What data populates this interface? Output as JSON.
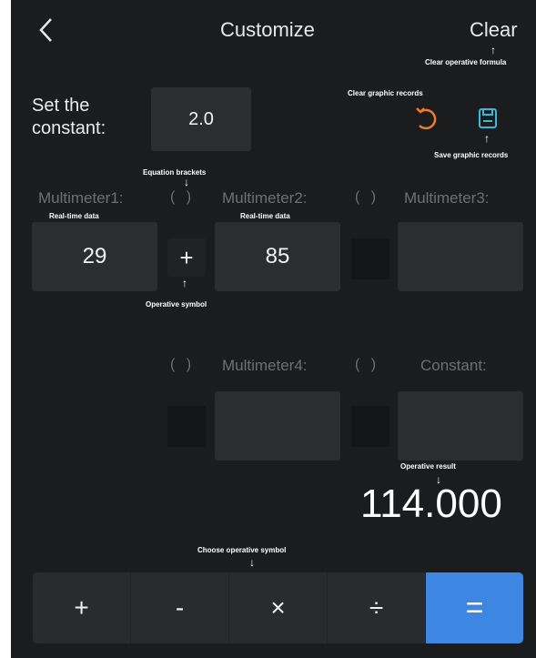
{
  "header": {
    "back_icon": "chevron-left-icon",
    "title": "Customize",
    "clear_label": "Clear"
  },
  "constant": {
    "label_line1": "Set the",
    "label_line2": "constant:",
    "value": "2.0"
  },
  "actions": {
    "clear_records_icon": "undo-icon",
    "save_records_icon": "save-icon",
    "accent_colors": {
      "undo": "#f07a2a",
      "save": "#3bb8d8"
    }
  },
  "brackets": "( )",
  "row1": {
    "m1_label": "Multimeter1:",
    "m1_value": "29",
    "m2_label": "Multimeter2:",
    "m2_value": "85",
    "m3_label": "Multimeter3:",
    "m3_value": "",
    "op1": "+"
  },
  "row2": {
    "m4_label": "Multimeter4:",
    "m4_value": "",
    "const_label": "Constant:",
    "const_value": ""
  },
  "result": "114.000",
  "annotations": {
    "clear_formula": "Clear operative formula",
    "clear_graphic": "Clear graphic records",
    "save_graphic": "Save graphic records",
    "equation_brackets": "Equation brackets",
    "realtime1": "Real-time data",
    "realtime2": "Real-time data",
    "operative_symbol": "Operative symbol",
    "operative_result": "Operative result",
    "choose_symbol": "Choose operative symbol"
  },
  "keyboard": {
    "plus": "+",
    "minus": "-",
    "times": "×",
    "divide": "÷",
    "equals": "=",
    "equals_color": "#3d86e2"
  }
}
